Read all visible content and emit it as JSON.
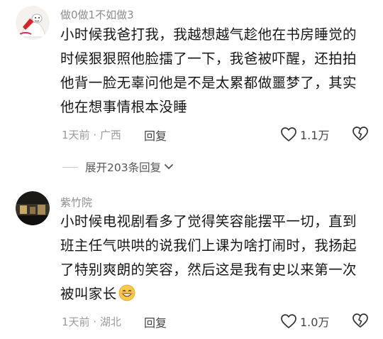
{
  "comment1": {
    "username": "做0做1不如做3",
    "lines": [
      "小时候我爸打我，我越想越气趁他在书房睡觉的",
      "时候狠狠照他脸擂了一下，我爸被吓醒，还拍拍",
      "他背一脸无辜问他是不是太累都做噩梦了，其实",
      "他在想事情根本没睡"
    ],
    "time": "1天前",
    "separator": "·",
    "location": "广西",
    "reply_label": "回复",
    "like_count": "1.1万"
  },
  "expand_replies": {
    "label": "展开203条回复"
  },
  "comment2": {
    "username": "紫竹院",
    "lines": [
      "小时候电视剧看多了觉得笑容能摆平一切，直到",
      "班主任气哄哄的说我们上课为啥打闹时，我扬起",
      "了特别爽朗的笑容，然后这是我有史以来第一次",
      "被叫家长"
    ],
    "time": "1天前",
    "separator": "·",
    "location": "湖北",
    "reply_label": "回复",
    "like_count": "1.0万"
  }
}
